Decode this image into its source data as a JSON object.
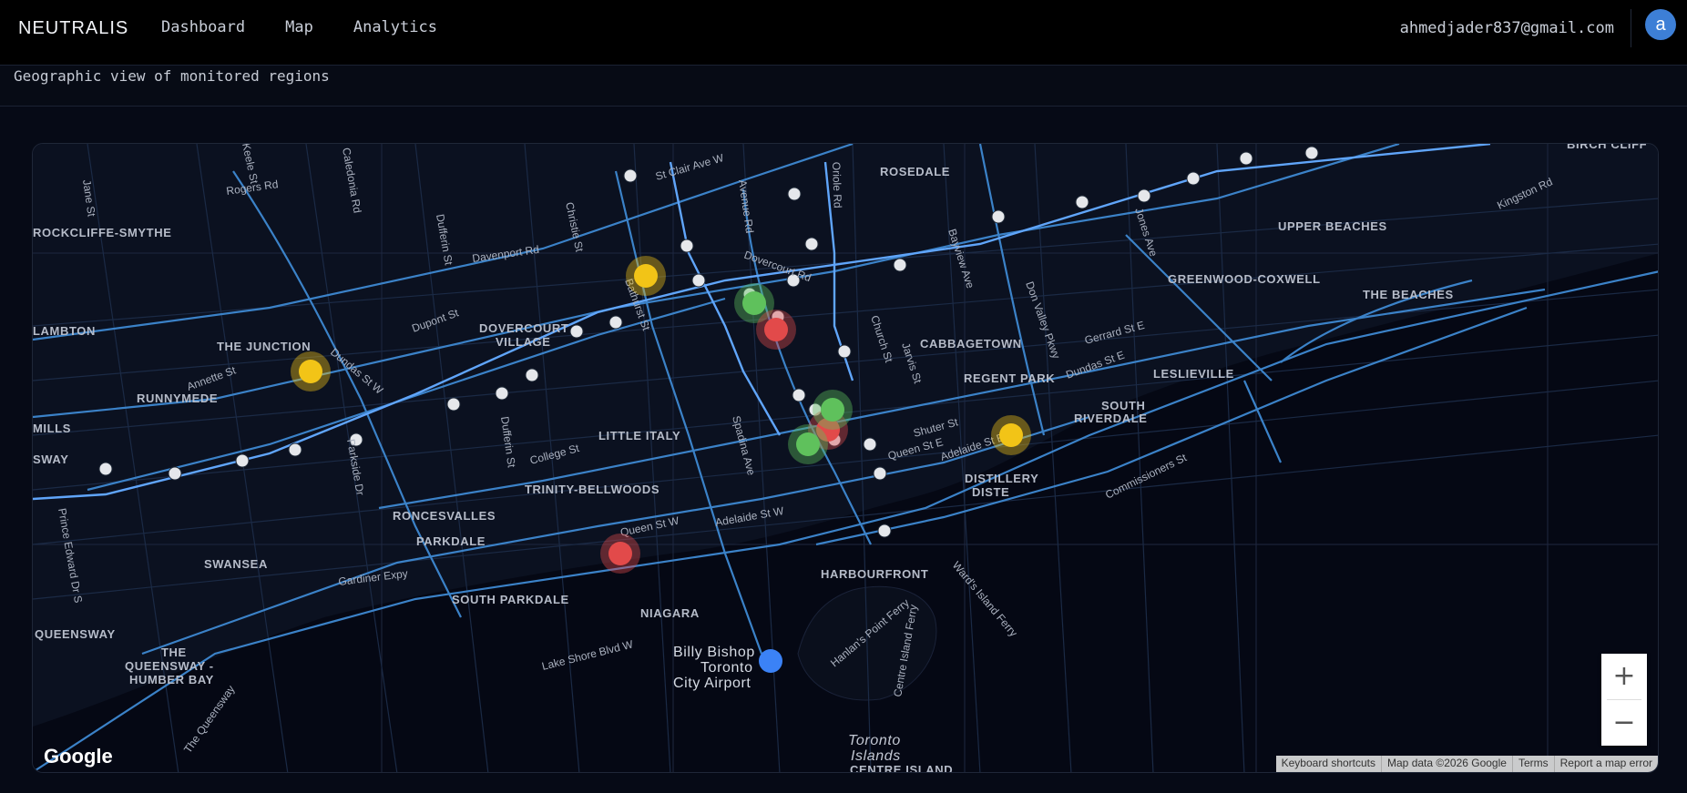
{
  "app": {
    "brand": "NEUTRALIS"
  },
  "nav": {
    "items": [
      "Dashboard",
      "Map",
      "Analytics"
    ]
  },
  "user": {
    "email": "ahmedjader837@gmail.com",
    "avatar_initial": "a"
  },
  "subheader": {
    "description": "Geographic view of monitored regions"
  },
  "map": {
    "provider_logo": "Google",
    "zoom_in": "+",
    "zoom_out": "−",
    "attribution": [
      "Keyboard shortcuts",
      "Map data ©2026 Google",
      "Terms",
      "Report a map error"
    ],
    "neighbourhood_labels": [
      "ROSEDALE",
      "ROCKCLIFFE-SMYTHE",
      "LAMBTON",
      "THE JUNCTION",
      "DOVERCOURT",
      "VILLAGE",
      "CABBAGETOWN",
      "REGENT PARK",
      "RUNNYMEDE",
      "MILLS",
      "SWAY",
      "LITTLE ITALY",
      "TRINITY-BELLWOODS",
      "RONCESVALLES",
      "PARKDALE",
      "SWANSEA",
      "SOUTH PARKDALE",
      "NIAGARA",
      "HARBOURFRONT",
      "DISTILLERY",
      "DISTE",
      "QUEENSWAY",
      "THE",
      "QUEENSWAY -",
      "HUMBER BAY",
      "UPPER BEACHES",
      "GREENWOOD-COXWELL",
      "THE BEACHES",
      "LESLIEVILLE",
      "SOUTH",
      "RIVERDALE",
      "BIRCH CLIFF",
      "Billy Bishop",
      "Toronto",
      "City Airport",
      "Toronto",
      "Islands",
      "CENTRE ISLAND"
    ],
    "street_labels": [
      "St Clair Ave W",
      "Rogers Rd",
      "Davenport Rd",
      "Dupont St",
      "Dundas St W",
      "Annette St",
      "College St",
      "Queen St W",
      "Adelaide St W",
      "Gardiner Expy",
      "Lake Shore Blvd W",
      "Bathurst St",
      "Spadina Ave",
      "Dufferin St",
      "Christie St",
      "Keele St",
      "Jane St",
      "Parkside Dr",
      "Church St",
      "Jarvis St",
      "Shuter St",
      "Queen St E",
      "Adelaide St E",
      "Dundas St E",
      "Gerrard St E",
      "Kingston Rd",
      "Commissioners St",
      "Bayview Ave",
      "Don Valley Pkwy",
      "Jones Ave",
      "Ward's Island Ferry",
      "Hanlan's Point Ferry",
      "Centre Island Ferry",
      "Prince Edward Dr S",
      "The Queensway",
      "Avenue Rd",
      "Oriole Rd",
      "Dovercourt Rd",
      "Caledonia Rd",
      "Dufferin St"
    ],
    "status_colors": {
      "good": "#5fc15c",
      "warning": "#f2c417",
      "critical": "#e24a4a"
    },
    "markers": [
      {
        "status": "warning"
      },
      {
        "status": "good"
      },
      {
        "status": "warning"
      },
      {
        "status": "critical"
      },
      {
        "status": "critical"
      },
      {
        "status": "good"
      },
      {
        "status": "good"
      },
      {
        "status": "warning"
      },
      {
        "status": "critical"
      },
      {
        "status": "good"
      }
    ]
  }
}
